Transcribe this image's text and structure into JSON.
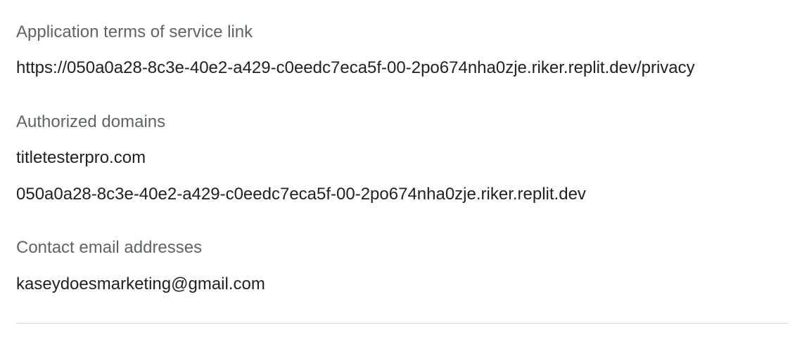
{
  "terms_of_service": {
    "label": "Application terms of service link",
    "url": "https://050a0a28-8c3e-40e2-a429-c0eedc7eca5f-00-2po674nha0zje.riker.replit.dev/privacy"
  },
  "authorized_domains": {
    "label": "Authorized domains",
    "items": [
      "titletesterpro.com",
      "050a0a28-8c3e-40e2-a429-c0eedc7eca5f-00-2po674nha0zje.riker.replit.dev"
    ]
  },
  "contact_emails": {
    "label": "Contact email addresses",
    "items": [
      "kaseydoesmarketing@gmail.com"
    ]
  }
}
